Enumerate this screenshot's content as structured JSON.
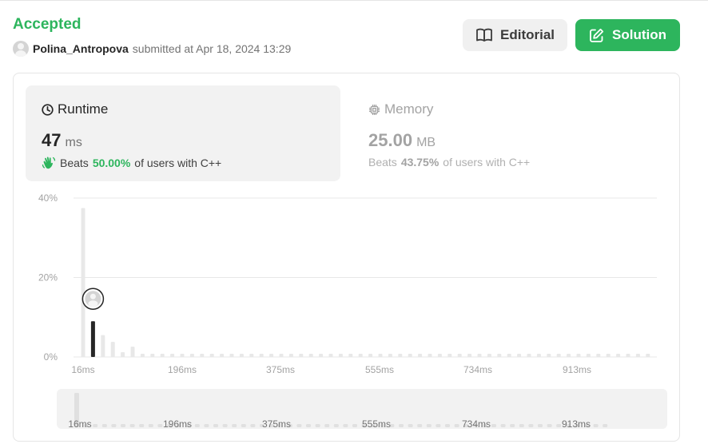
{
  "header": {
    "status": "Accepted",
    "username": "Polina_Antropova",
    "submitted_text": "submitted at Apr 18, 2024 13:29"
  },
  "buttons": {
    "editorial": "Editorial",
    "solution": "Solution"
  },
  "runtime": {
    "title": "Runtime",
    "value": "47",
    "unit": "ms",
    "beats_label": "Beats",
    "beats_pct": "50.00%",
    "beats_suffix": "of users with C++"
  },
  "memory": {
    "title": "Memory",
    "value": "25.00",
    "unit": "MB",
    "beats_label": "Beats",
    "beats_pct": "43.75%",
    "beats_suffix": "of users with C++"
  },
  "colors": {
    "accent_green": "#2db55d",
    "bar_default": "#e8e8e8",
    "bar_user": "#262626"
  },
  "chart_data": {
    "type": "bar",
    "xlabel": "",
    "ylabel": "",
    "ylim": [
      0,
      40
    ],
    "y_ticks": [
      "40%",
      "20%",
      "0%"
    ],
    "x_tick_labels": [
      "16ms",
      "196ms",
      "375ms",
      "555ms",
      "734ms",
      "913ms"
    ],
    "bin_width_ms": 15,
    "x_start_ms": 16,
    "values": [
      37.5,
      9,
      5.5,
      3.8,
      1.2,
      2.6,
      0.8,
      0.8,
      0.8,
      0.8,
      0.8,
      0.8,
      0.8,
      0.8,
      0.8,
      0.8,
      0.8,
      0.8,
      0.8,
      0.8,
      0.8,
      0.8,
      0.8,
      0.8,
      0.8,
      0.8,
      0.8,
      0.8,
      0.8,
      0.8,
      0.8,
      0.8,
      0.8,
      0.8,
      0.8,
      0.8,
      0.8,
      0.8,
      0.8,
      0.8,
      0.8,
      0.8,
      0.8,
      0.8,
      0.8,
      0.8,
      0.8,
      0.8,
      0.8,
      0.8,
      0.8,
      0.8,
      0.8,
      0.8,
      0.8,
      0.8,
      0.8,
      0.8
    ],
    "user_bin_index": 1,
    "grid": true,
    "legend": "none"
  }
}
